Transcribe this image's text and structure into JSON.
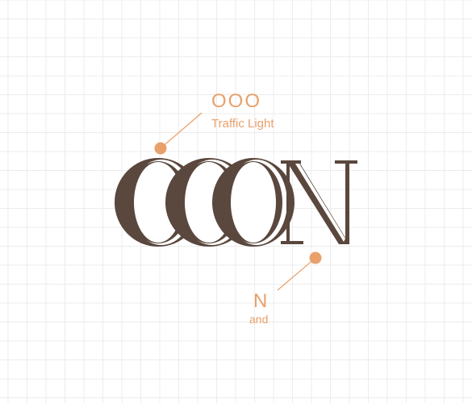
{
  "colors": {
    "background": "#ffffff",
    "grid": "#ececec",
    "logo": "#5a473d",
    "accent": "#e9a06b"
  },
  "logo": {
    "letters": [
      "O",
      "O",
      "O",
      "N"
    ]
  },
  "callouts": {
    "top": {
      "title": "OOO",
      "subtitle": "Traffic Light"
    },
    "bottom": {
      "title": "N",
      "subtitle": "and"
    }
  }
}
